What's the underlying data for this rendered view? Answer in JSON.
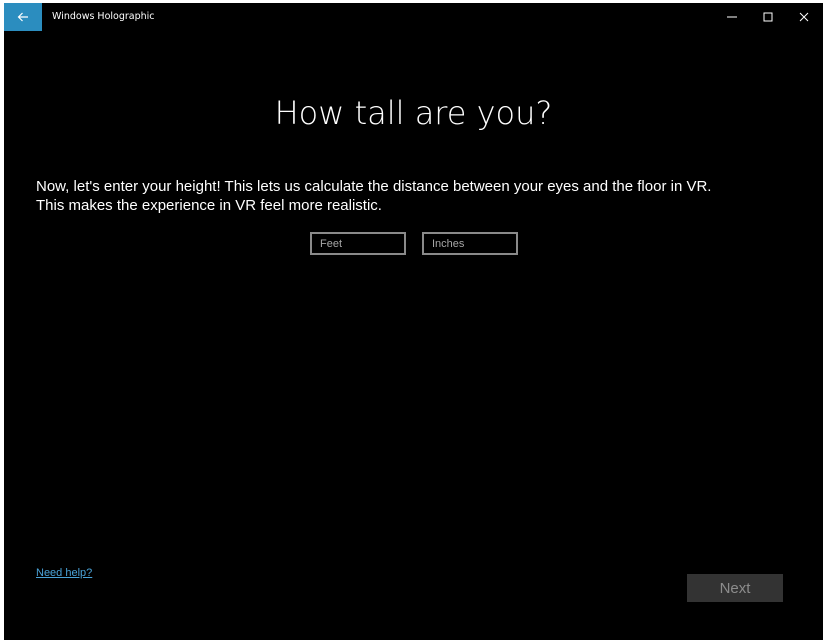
{
  "window": {
    "title": "Windows Holographic",
    "accent_color": "#2b8dbf",
    "icons": {
      "back": "back-arrow-icon",
      "minimize": "minimize-icon",
      "maximize": "maximize-icon",
      "close": "close-icon"
    }
  },
  "main": {
    "heading": "How tall are you?",
    "description_line1": "Now, let's enter your height! This lets us calculate the distance between your eyes and the floor in VR.",
    "description_line2": "This makes the experience in VR feel more realistic.",
    "feet_input": {
      "placeholder": "Feet",
      "value": ""
    },
    "inches_input": {
      "placeholder": "Inches",
      "value": ""
    }
  },
  "footer": {
    "help_link": "Need help?",
    "next_label": "Next"
  }
}
